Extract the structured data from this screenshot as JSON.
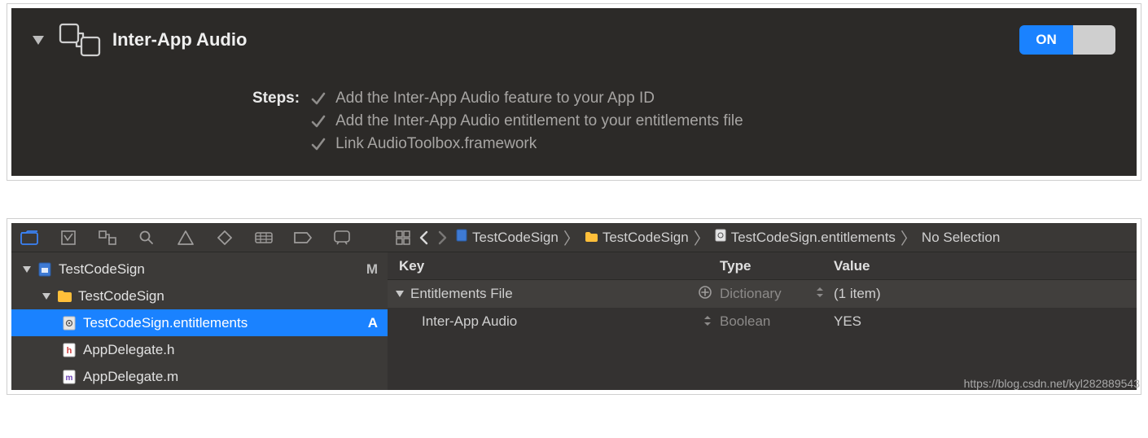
{
  "capability": {
    "title": "Inter-App Audio",
    "switch_state": "ON",
    "steps_label": "Steps:",
    "steps": [
      "Add the Inter-App Audio feature to your App ID",
      "Add the Inter-App Audio entitlement to your entitlements file",
      "Link AudioToolbox.framework"
    ]
  },
  "navigator": {
    "tabs": [
      "project",
      "source-control",
      "symbol",
      "find",
      "issue",
      "test",
      "debug",
      "breakpoint",
      "report"
    ]
  },
  "project_tree": {
    "root": {
      "name": "TestCodeSign",
      "status": "M"
    },
    "group": {
      "name": "TestCodeSign"
    },
    "files": [
      {
        "name": "TestCodeSign.entitlements",
        "status": "A",
        "selected": true,
        "kind": "entitlements"
      },
      {
        "name": "AppDelegate.h",
        "kind": "h"
      },
      {
        "name": "AppDelegate.m",
        "kind": "m"
      }
    ]
  },
  "breadcrumb": {
    "segments": [
      {
        "icon": "project",
        "text": "TestCodeSign"
      },
      {
        "icon": "folder",
        "text": "TestCodeSign"
      },
      {
        "icon": "entitlements",
        "text": "TestCodeSign.entitlements"
      },
      {
        "text": "No Selection"
      }
    ]
  },
  "plist": {
    "headers": {
      "key": "Key",
      "type": "Type",
      "value": "Value"
    },
    "rows": [
      {
        "key": "Entitlements File",
        "type": "Dictionary",
        "value": "(1 item)",
        "expandable": true,
        "selected": true,
        "level": 0,
        "showAdd": true
      },
      {
        "key": "Inter-App Audio",
        "type": "Boolean",
        "value": "YES",
        "level": 1,
        "chevron": true
      }
    ]
  },
  "watermark": "https://blog.csdn.net/kyl282889543"
}
